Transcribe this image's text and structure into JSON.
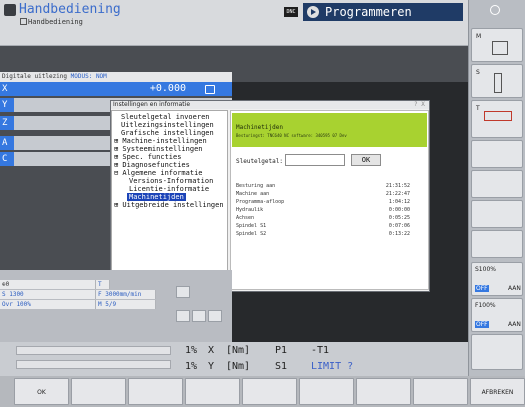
{
  "header": {
    "mode_title": "Handbediening",
    "mode_subtitle": "Handbediening",
    "dnc_badge": "DNC",
    "program_tab": "Programmeren"
  },
  "status": {
    "readout_label": "Digitale uitlezing",
    "mode_label": "MODUS: NOM"
  },
  "axes": [
    {
      "letter": "X",
      "value": "+0.000"
    },
    {
      "letter": "Y",
      "value": ""
    },
    {
      "letter": "Z",
      "value": ""
    },
    {
      "letter": "A",
      "value": ""
    },
    {
      "letter": "C",
      "value": ""
    }
  ],
  "dialog": {
    "title": "Instellingen en informatie",
    "close": "? X",
    "tree": [
      {
        "label": "Sleutelgetal invoeren",
        "indent": 1
      },
      {
        "label": "Uitlezingsinstellingen",
        "indent": 1
      },
      {
        "label": "Grafische instellingen",
        "indent": 1
      },
      {
        "label": "⊞ Machine-instellingen",
        "indent": 0
      },
      {
        "label": "⊞ Systeeminstellingen",
        "indent": 0
      },
      {
        "label": "⊞ Spec. functies",
        "indent": 0
      },
      {
        "label": "⊞ Diagnosefuncties",
        "indent": 0
      },
      {
        "label": "⊟ Algemene informatie",
        "indent": 0
      },
      {
        "label": "Versions-Information",
        "indent": 2
      },
      {
        "label": "Licentie-informatie",
        "indent": 2
      },
      {
        "label": "Machinetijden",
        "indent": 2,
        "selected": true
      },
      {
        "label": "⊞ Uitgebreide instellingen",
        "indent": 0
      }
    ],
    "panel": {
      "heading": "Machinetijden",
      "subheading": "Besturingst: TNC640     NC software: 340595 07 Dev",
      "key_label": "Sleutelgetal:",
      "ok_label": "OK",
      "rows": [
        {
          "label": "Besturing aan",
          "value": "21:31:52"
        },
        {
          "label": "Machine aan",
          "value": "21:22:47"
        },
        {
          "label": "Programma-afloop",
          "value": "1:04:12"
        },
        {
          "label": "Hydraulik",
          "value": "0:00:00"
        },
        {
          "label": "Achsen",
          "value": "0:05:25"
        },
        {
          "label": "Spindel S1",
          "value": "0:07:06"
        },
        {
          "label": "Spindel S2",
          "value": "0:13:22"
        }
      ]
    }
  },
  "bottom_left": {
    "r1_left": "⊕0",
    "r1_right": "T",
    "r2_left": "S 1300",
    "r2_right": "F 3000mm/min",
    "r3_left": "Ovr 100%",
    "r3_right": "M 5/9"
  },
  "status_line": {
    "row1": {
      "pct": "1%",
      "axis": "X",
      "unit": "[Nm]",
      "p": "P1",
      "t": "-T1"
    },
    "row2": {
      "pct": "1%",
      "axis": "Y",
      "unit": "[Nm]",
      "s": "S1",
      "limit": "LIMIT ?"
    }
  },
  "right_softkeys": {
    "m_label": "M",
    "s_label": "S",
    "t_label": "T",
    "s100": "S100%",
    "s_off": "OFF",
    "s_on": "AAN",
    "f100": "F100%",
    "f_off": "OFF",
    "f_on": "AAN"
  },
  "softkeys": {
    "ok": "OK",
    "afbreken": "AFBREKEN"
  }
}
